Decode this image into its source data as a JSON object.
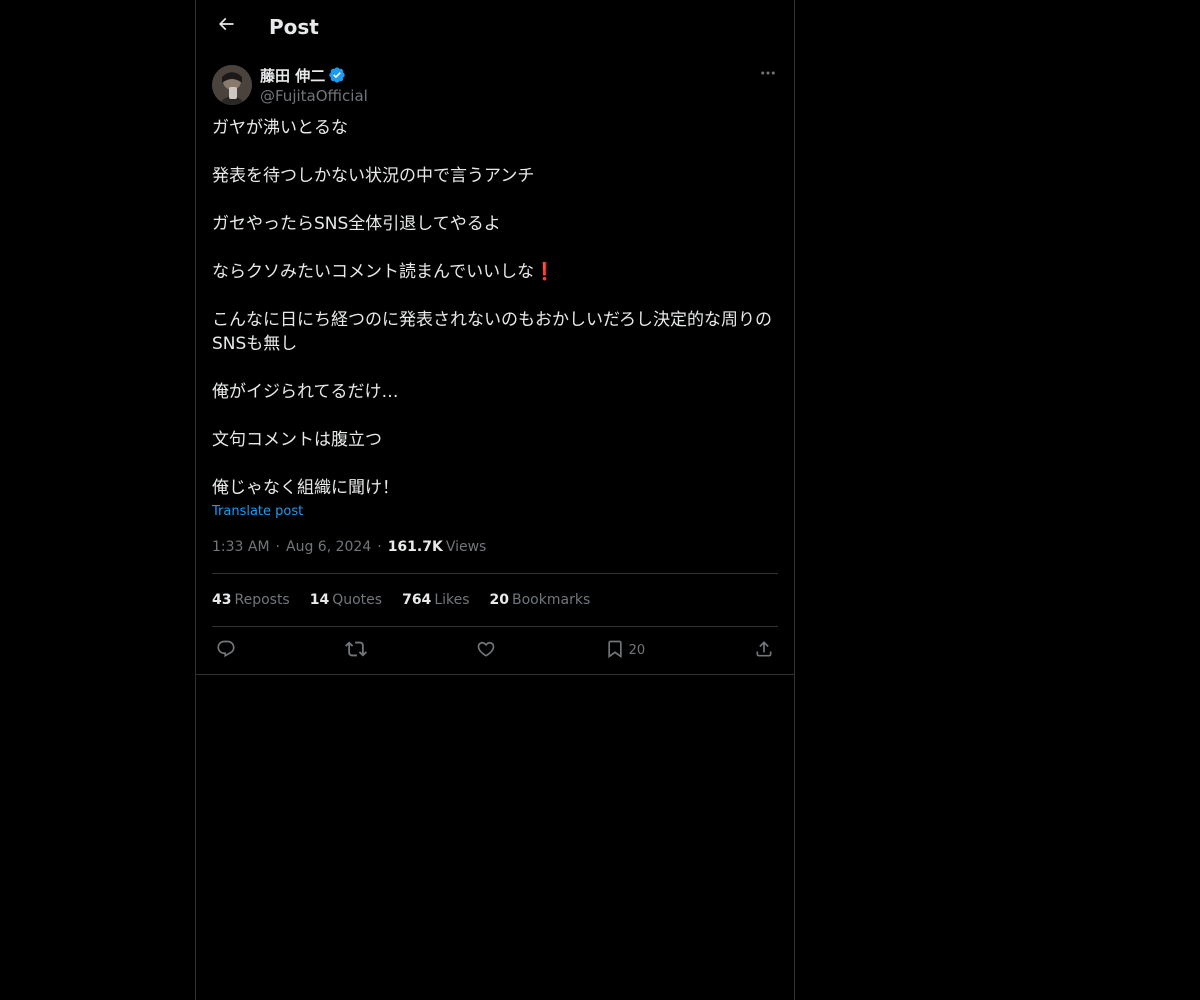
{
  "header": {
    "title": "Post",
    "back_icon": "arrow-left-icon"
  },
  "author": {
    "display_name": "藤田 伸二",
    "handle": "@FujitaOfficial",
    "verified_color": "#1d9bf0"
  },
  "post": {
    "paragraphs": [
      "ガヤが沸いとるな",
      "発表を待つしかない状況の中で言うアンチ",
      "ガセやったらSNS全体引退してやるよ",
      "ならクソみたいコメント読まんでいいしな",
      "こんなに日にち経つのに発表されないのもおかしいだろし決定的な周りのSNSも無し",
      "俺がイジられてるだけ…",
      "文句コメントは腹立つ",
      "俺じゃなく組織に聞け！"
    ],
    "exclamation_emoji": "❗",
    "translate_label": "Translate post",
    "time": "1:33 AM",
    "date": "Aug 6, 2024",
    "views_count": "161.7K",
    "views_label": "Views"
  },
  "stats": {
    "reposts_count": "43",
    "reposts_label": "Reposts",
    "quotes_count": "14",
    "quotes_label": "Quotes",
    "likes_count": "764",
    "likes_label": "Likes",
    "bookmarks_count": "20",
    "bookmarks_label": "Bookmarks"
  },
  "actions": {
    "reply_icon": "reply-icon",
    "repost_icon": "repost-icon",
    "like_icon": "heart-icon",
    "bookmark_icon": "bookmark-icon",
    "bookmark_count": "20",
    "share_icon": "share-icon"
  },
  "colors": {
    "background": "#000000",
    "text": "#e7e9ea",
    "muted": "#71767b",
    "accent": "#1d9bf0",
    "border": "#2f3336"
  }
}
